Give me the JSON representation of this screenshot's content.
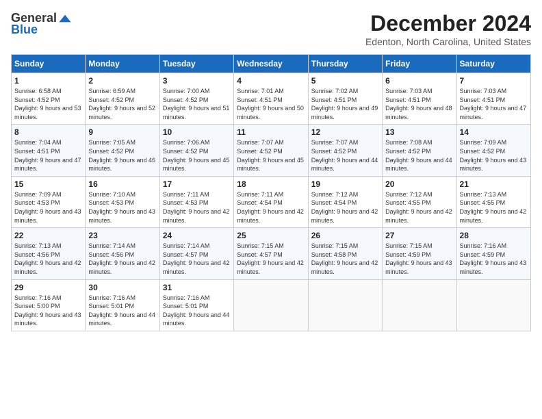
{
  "logo": {
    "general": "General",
    "blue": "Blue"
  },
  "title": "December 2024",
  "location": "Edenton, North Carolina, United States",
  "weekdays": [
    "Sunday",
    "Monday",
    "Tuesday",
    "Wednesday",
    "Thursday",
    "Friday",
    "Saturday"
  ],
  "weeks": [
    [
      {
        "day": "1",
        "sunrise": "6:58 AM",
        "sunset": "4:52 PM",
        "daylight": "9 hours and 53 minutes."
      },
      {
        "day": "2",
        "sunrise": "6:59 AM",
        "sunset": "4:52 PM",
        "daylight": "9 hours and 52 minutes."
      },
      {
        "day": "3",
        "sunrise": "7:00 AM",
        "sunset": "4:52 PM",
        "daylight": "9 hours and 51 minutes."
      },
      {
        "day": "4",
        "sunrise": "7:01 AM",
        "sunset": "4:51 PM",
        "daylight": "9 hours and 50 minutes."
      },
      {
        "day": "5",
        "sunrise": "7:02 AM",
        "sunset": "4:51 PM",
        "daylight": "9 hours and 49 minutes."
      },
      {
        "day": "6",
        "sunrise": "7:03 AM",
        "sunset": "4:51 PM",
        "daylight": "9 hours and 48 minutes."
      },
      {
        "day": "7",
        "sunrise": "7:03 AM",
        "sunset": "4:51 PM",
        "daylight": "9 hours and 47 minutes."
      }
    ],
    [
      {
        "day": "8",
        "sunrise": "7:04 AM",
        "sunset": "4:51 PM",
        "daylight": "9 hours and 47 minutes."
      },
      {
        "day": "9",
        "sunrise": "7:05 AM",
        "sunset": "4:52 PM",
        "daylight": "9 hours and 46 minutes."
      },
      {
        "day": "10",
        "sunrise": "7:06 AM",
        "sunset": "4:52 PM",
        "daylight": "9 hours and 45 minutes."
      },
      {
        "day": "11",
        "sunrise": "7:07 AM",
        "sunset": "4:52 PM",
        "daylight": "9 hours and 45 minutes."
      },
      {
        "day": "12",
        "sunrise": "7:07 AM",
        "sunset": "4:52 PM",
        "daylight": "9 hours and 44 minutes."
      },
      {
        "day": "13",
        "sunrise": "7:08 AM",
        "sunset": "4:52 PM",
        "daylight": "9 hours and 44 minutes."
      },
      {
        "day": "14",
        "sunrise": "7:09 AM",
        "sunset": "4:52 PM",
        "daylight": "9 hours and 43 minutes."
      }
    ],
    [
      {
        "day": "15",
        "sunrise": "7:09 AM",
        "sunset": "4:53 PM",
        "daylight": "9 hours and 43 minutes."
      },
      {
        "day": "16",
        "sunrise": "7:10 AM",
        "sunset": "4:53 PM",
        "daylight": "9 hours and 43 minutes."
      },
      {
        "day": "17",
        "sunrise": "7:11 AM",
        "sunset": "4:53 PM",
        "daylight": "9 hours and 42 minutes."
      },
      {
        "day": "18",
        "sunrise": "7:11 AM",
        "sunset": "4:54 PM",
        "daylight": "9 hours and 42 minutes."
      },
      {
        "day": "19",
        "sunrise": "7:12 AM",
        "sunset": "4:54 PM",
        "daylight": "9 hours and 42 minutes."
      },
      {
        "day": "20",
        "sunrise": "7:12 AM",
        "sunset": "4:55 PM",
        "daylight": "9 hours and 42 minutes."
      },
      {
        "day": "21",
        "sunrise": "7:13 AM",
        "sunset": "4:55 PM",
        "daylight": "9 hours and 42 minutes."
      }
    ],
    [
      {
        "day": "22",
        "sunrise": "7:13 AM",
        "sunset": "4:56 PM",
        "daylight": "9 hours and 42 minutes."
      },
      {
        "day": "23",
        "sunrise": "7:14 AM",
        "sunset": "4:56 PM",
        "daylight": "9 hours and 42 minutes."
      },
      {
        "day": "24",
        "sunrise": "7:14 AM",
        "sunset": "4:57 PM",
        "daylight": "9 hours and 42 minutes."
      },
      {
        "day": "25",
        "sunrise": "7:15 AM",
        "sunset": "4:57 PM",
        "daylight": "9 hours and 42 minutes."
      },
      {
        "day": "26",
        "sunrise": "7:15 AM",
        "sunset": "4:58 PM",
        "daylight": "9 hours and 42 minutes."
      },
      {
        "day": "27",
        "sunrise": "7:15 AM",
        "sunset": "4:59 PM",
        "daylight": "9 hours and 43 minutes."
      },
      {
        "day": "28",
        "sunrise": "7:16 AM",
        "sunset": "4:59 PM",
        "daylight": "9 hours and 43 minutes."
      }
    ],
    [
      {
        "day": "29",
        "sunrise": "7:16 AM",
        "sunset": "5:00 PM",
        "daylight": "9 hours and 43 minutes."
      },
      {
        "day": "30",
        "sunrise": "7:16 AM",
        "sunset": "5:01 PM",
        "daylight": "9 hours and 44 minutes."
      },
      {
        "day": "31",
        "sunrise": "7:16 AM",
        "sunset": "5:01 PM",
        "daylight": "9 hours and 44 minutes."
      },
      null,
      null,
      null,
      null
    ]
  ],
  "labels": {
    "sunrise": "Sunrise:",
    "sunset": "Sunset:",
    "daylight": "Daylight:"
  }
}
